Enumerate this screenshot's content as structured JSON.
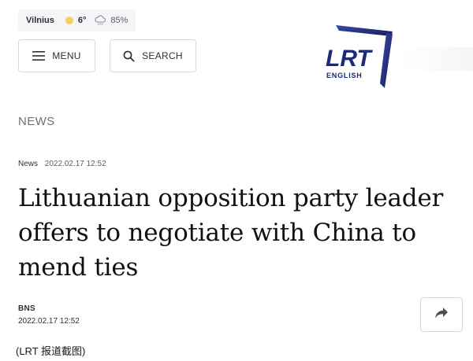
{
  "weather": {
    "city": "Vilnius",
    "temperature": "6°",
    "humidity": "85%",
    "sun_color": "#f6d35c"
  },
  "header": {
    "menu_label": "MENU",
    "search_label": "SEARCH",
    "logo_text": "LRT",
    "logo_subtext": "ENGLISH",
    "brand_color": "#1c2a7a"
  },
  "article": {
    "section": "NEWS",
    "category": "News",
    "datetime": "2022.02.17 12:52",
    "headline": "Lithuanian opposition party leader offers to negotiate with China to mend ties",
    "author": "BNS",
    "published": "2022.02.17 12:52",
    "share_icon": "share-arrow-icon"
  },
  "caption": "(LRT 报道截图)"
}
